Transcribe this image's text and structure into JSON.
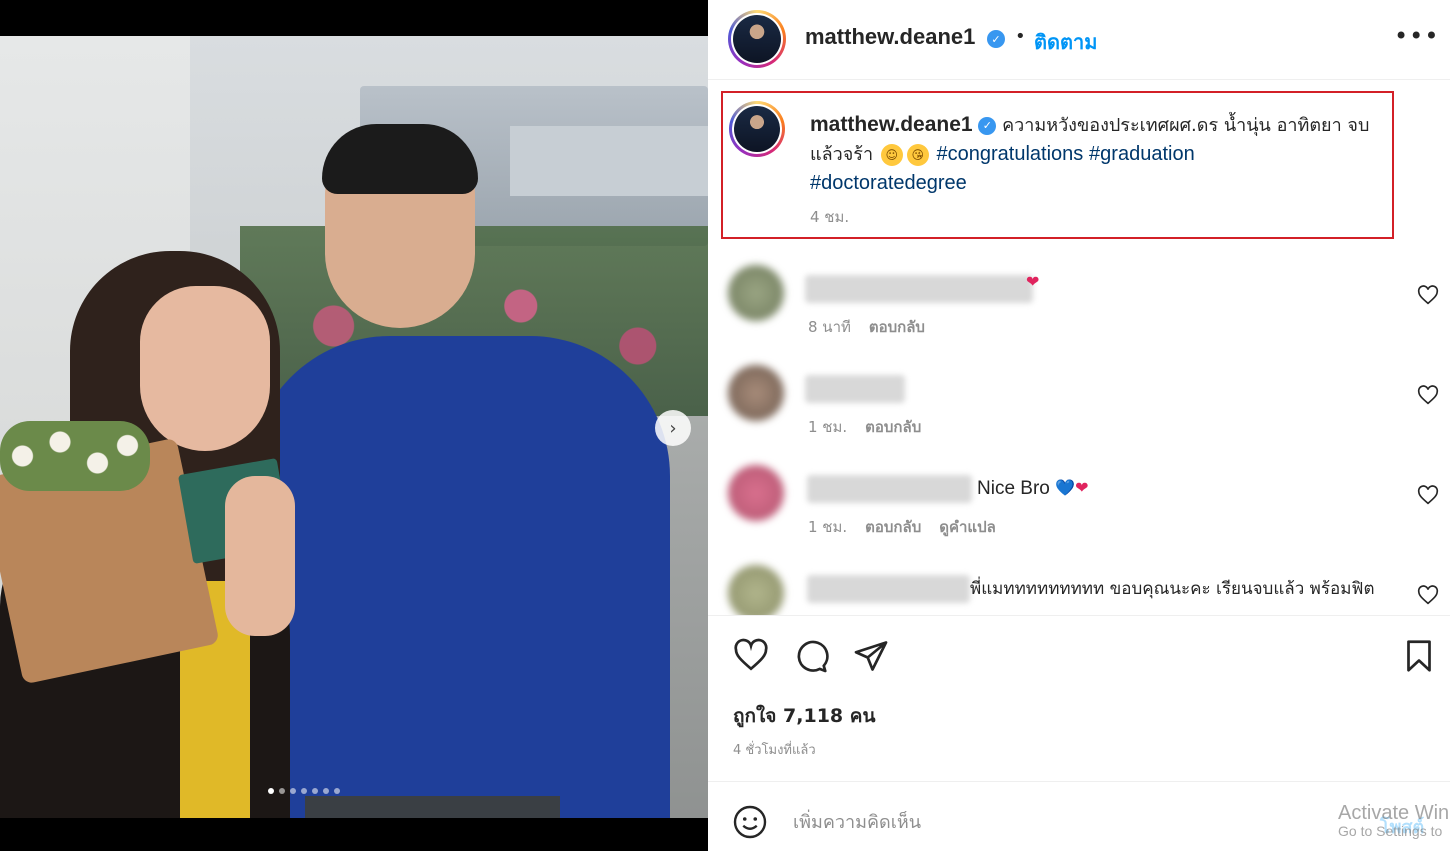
{
  "post": {
    "username": "matthew.deane1",
    "follow_label": "ติดตาม",
    "more_label": "•••",
    "caption_text": "ความหวังของประเทศผศ.ดร น้ำนุ่น อาทิตยา จบแล้วจร้า",
    "hashtags": [
      "#congratulations",
      "#graduation",
      "#doctoratedegree"
    ],
    "caption_time": "4 ชม.",
    "image_dots": 7,
    "active_dot": 0
  },
  "comments": [
    {
      "text": "",
      "time": "8 นาที",
      "reply": "ตอบกลับ",
      "emoji": "❤"
    },
    {
      "text": "",
      "time": "1 ชม.",
      "reply": "ตอบกลับ",
      "emoji": ""
    },
    {
      "text": "Nice Bro",
      "time": "1 ชม.",
      "reply": "ตอบกลับ",
      "translate": "ดูคำแปล",
      "emoji": "💙❤"
    },
    {
      "text": "พี่แมททททททททท ขอบคุณนะคะ เรียนจบแล้ว พร้อมฟิต",
      "time": "",
      "reply": "",
      "emoji": ""
    }
  ],
  "footer": {
    "likes": "ถูกใจ 7,118 คน",
    "posted": "4 ชั่วโมงที่แล้ว",
    "comment_placeholder": "เพิ่มความคิดเห็น",
    "post_label": "โพสต์"
  },
  "watermark": {
    "line1": "Activate Win",
    "line2": "Go to Settings to"
  },
  "colors": {
    "link": "#0095f6",
    "hashtag": "#00376b",
    "highlight_border": "#d32027",
    "muted": "#8e8e8e"
  }
}
